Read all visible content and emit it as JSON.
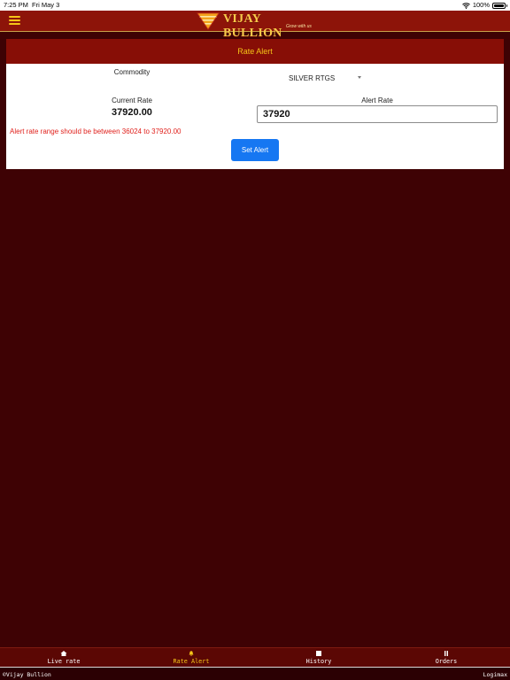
{
  "status_bar": {
    "time": "7:25 PM",
    "date": "Fri May 3",
    "battery": "100%"
  },
  "header": {
    "logo_title": "VIJAY BULLION",
    "logo_tagline": "Grow with us"
  },
  "rate_alert": {
    "title": "Rate Alert",
    "commodity_label": "Commodity",
    "commodity_selected": "SILVER RTGS",
    "current_rate_label": "Current Rate",
    "current_rate_value": "37920.00",
    "alert_rate_label": "Alert Rate",
    "alert_rate_value": "37920",
    "range_message": "Alert rate range should be between 36024 to 37920.00",
    "set_alert_label": "Set Alert"
  },
  "tabs": [
    {
      "label": "Live rate",
      "icon": "home-icon",
      "active": false
    },
    {
      "label": "Rate Alert",
      "icon": "bell-icon",
      "active": true
    },
    {
      "label": "History",
      "icon": "history-icon",
      "active": false
    },
    {
      "label": "Orders",
      "icon": "orders-icon",
      "active": false
    }
  ],
  "footer": {
    "copyright": "©Vijay Bullion",
    "vendor": "Logimax"
  },
  "colors": {
    "page_background": "#3e0204",
    "header_background": "#8d1409",
    "accent_gold": "#f5c518",
    "error_red": "#e0211c",
    "button_blue": "#1677f2"
  }
}
